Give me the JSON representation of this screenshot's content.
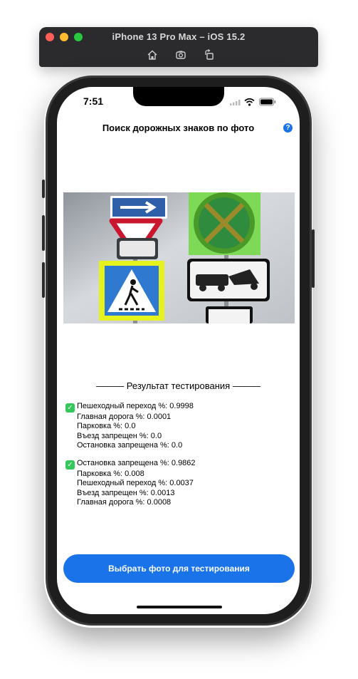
{
  "simulator": {
    "title": "iPhone 13 Pro Max – iOS 15.2",
    "toolbar": [
      "home-icon",
      "screenshot-icon",
      "rotate-icon"
    ]
  },
  "status_bar": {
    "time": "7:51",
    "icons": [
      "signal-icon",
      "wifi-icon",
      "battery-icon"
    ]
  },
  "nav": {
    "title": "Поиск дорожных знаков по фото",
    "help_icon": "?"
  },
  "results": {
    "header": "——— Результат тестирования ———",
    "groups": [
      {
        "lines": [
          "Пешеходный переход %: 0.9998",
          "Главная дорога %: 0.0001",
          "Парковка %: 0.0",
          "Въезд запрещен %: 0.0",
          "Остановка запрещена %: 0.0"
        ]
      },
      {
        "lines": [
          "Остановка запрещена %: 0.9862",
          "Парковка %: 0.008",
          "Пешеходный переход %: 0.0037",
          "Въезд запрещен %: 0.0013",
          "Главная дорога %: 0.0008"
        ]
      }
    ]
  },
  "action_button": {
    "label": "Выбрать фото для тестирования"
  },
  "colors": {
    "accent": "#1a73e8",
    "check": "#34c759",
    "highlight": "#7ed957"
  }
}
